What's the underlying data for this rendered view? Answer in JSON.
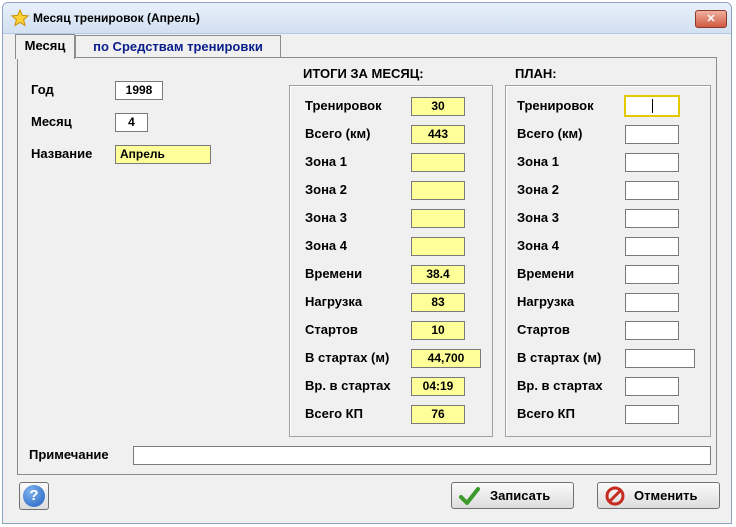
{
  "window": {
    "title": "Месяц тренировок  (Апрель)",
    "close_label": "✕"
  },
  "tabs": [
    {
      "label": "Месяц",
      "active": true
    },
    {
      "label": "по Средствам тренировки",
      "active": false
    }
  ],
  "left": {
    "year_label": "Год",
    "year_value": "1998",
    "month_label": "Месяц",
    "month_value": "4",
    "name_label": "Название",
    "name_value": "Апрель"
  },
  "totals": {
    "header": "ИТОГИ ЗА МЕСЯЦ:",
    "rows": [
      {
        "label": "Тренировок",
        "value": "30"
      },
      {
        "label": "Всего (км)",
        "value": "443"
      },
      {
        "label": "Зона 1",
        "value": ""
      },
      {
        "label": "Зона 2",
        "value": ""
      },
      {
        "label": "Зона 3",
        "value": ""
      },
      {
        "label": "Зона 4",
        "value": ""
      },
      {
        "label": "Времени",
        "value": "38.4"
      },
      {
        "label": "Нагрузка",
        "value": "83"
      },
      {
        "label": "Стартов",
        "value": "10"
      },
      {
        "label": "В стартах (м)",
        "value": "44,700"
      },
      {
        "label": "Вр. в стартах",
        "value": "04:19"
      },
      {
        "label": "Всего КП",
        "value": "76"
      }
    ]
  },
  "plan": {
    "header": "ПЛАН:",
    "rows": [
      {
        "label": "Тренировок",
        "value": ""
      },
      {
        "label": "Всего (км)",
        "value": ""
      },
      {
        "label": "Зона 1",
        "value": ""
      },
      {
        "label": "Зона 2",
        "value": ""
      },
      {
        "label": "Зона 3",
        "value": ""
      },
      {
        "label": "Зона 4",
        "value": ""
      },
      {
        "label": "Времени",
        "value": ""
      },
      {
        "label": "Нагрузка",
        "value": ""
      },
      {
        "label": "Стартов",
        "value": ""
      },
      {
        "label": "В стартах (м)",
        "value": ""
      },
      {
        "label": "Вр. в стартах",
        "value": ""
      },
      {
        "label": "Всего КП",
        "value": ""
      }
    ]
  },
  "note": {
    "label": "Примечание",
    "value": ""
  },
  "buttons": {
    "help_icon": "?",
    "save_label": "Записать",
    "cancel_label": "Отменить"
  },
  "colors": {
    "field_yellow": "#ffff99",
    "focus_border": "#e6c800"
  }
}
